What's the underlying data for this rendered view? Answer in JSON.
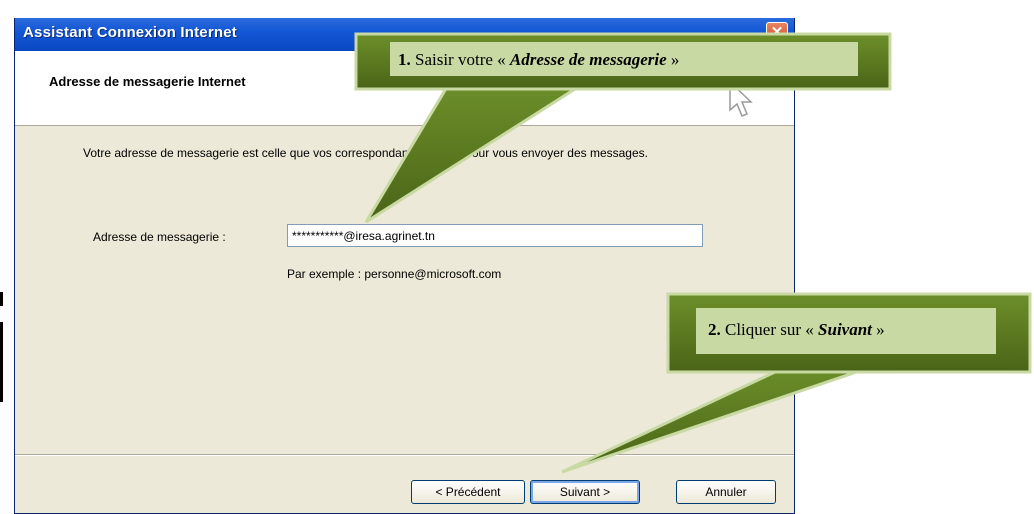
{
  "window": {
    "title": "Assistant Connexion Internet",
    "close_label": "✕"
  },
  "header": {
    "heading": "Adresse de messagerie Internet"
  },
  "content": {
    "description": "Votre adresse de messagerie est celle que vos correspondants utilisent pour vous envoyer des messages.",
    "field_label": "Adresse de messagerie :",
    "email_value": "***********@iresa.agrinet.tn",
    "example_text": "Par exemple : personne@microsoft.com"
  },
  "buttons": {
    "back": "< Précédent",
    "next": "Suivant >",
    "cancel": "Annuler"
  },
  "callouts": {
    "step1": {
      "number": "1.",
      "text_before": " Saisir votre « ",
      "emphasis": "Adresse de messagerie",
      "text_after": " »"
    },
    "step2": {
      "number": "2.",
      "text_before": " Cliquer sur « ",
      "emphasis": "Suivant",
      "text_after": " »"
    }
  },
  "colors": {
    "callout_fill": "#5a7a1e",
    "callout_light": "#c8d9a3",
    "titlebar": "#1457d6"
  },
  "icons": {
    "cursor": "arrow-pointer-icon"
  }
}
